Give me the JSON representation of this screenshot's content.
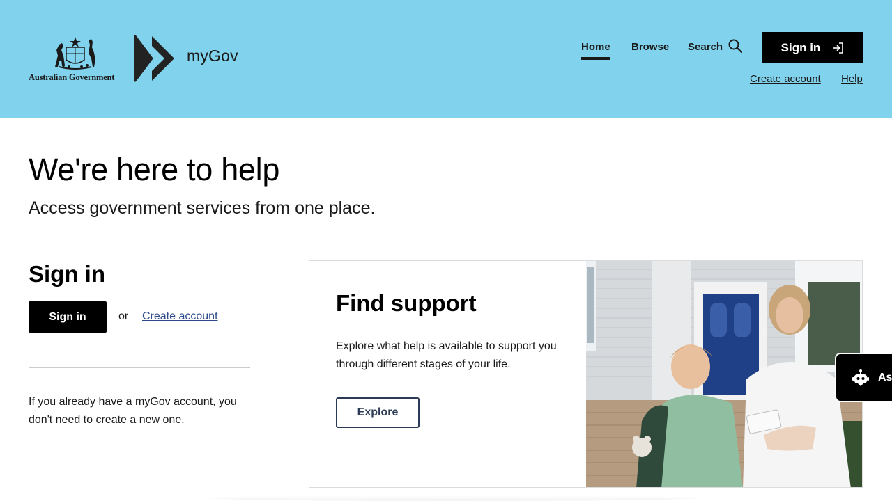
{
  "header": {
    "crest_text": "Australian Government",
    "brand_name": "myGov",
    "nav": {
      "home": "Home",
      "browse": "Browse",
      "search": "Search"
    },
    "sign_in_label": "Sign in",
    "create_account": "Create account",
    "help": "Help",
    "background_color": "#81d2ec"
  },
  "hero": {
    "title": "We're here to help",
    "subtitle": "Access government services from one place."
  },
  "signin_panel": {
    "heading": "Sign in",
    "button": "Sign in",
    "or": "or",
    "create_link": "Create account",
    "info": "If you already have a myGov account, you don't need to create a new one."
  },
  "support_card": {
    "title": "Find support",
    "text": "Explore what help is available to support you through different stages of your life.",
    "button": "Explore"
  },
  "assistant": {
    "label": "As",
    "icon": "robot-icon"
  }
}
